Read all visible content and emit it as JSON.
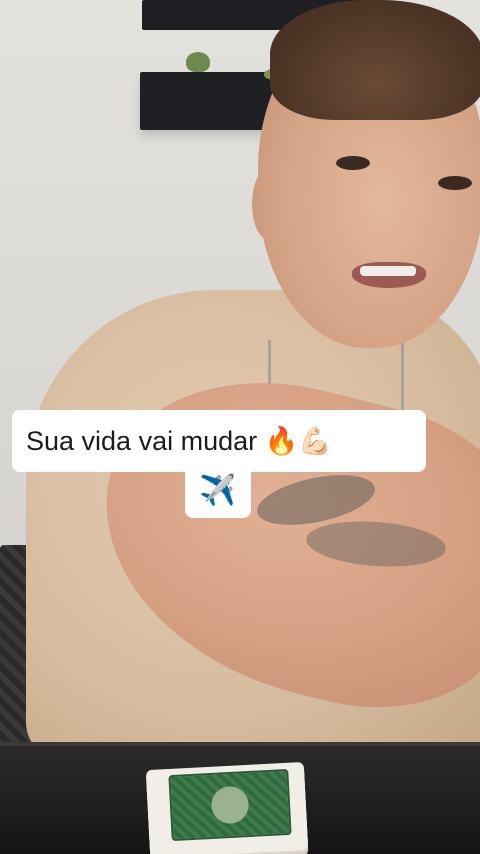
{
  "caption": {
    "line1": "Sua vida vai mudar 🔥💪🏻",
    "line2": "✈️"
  }
}
